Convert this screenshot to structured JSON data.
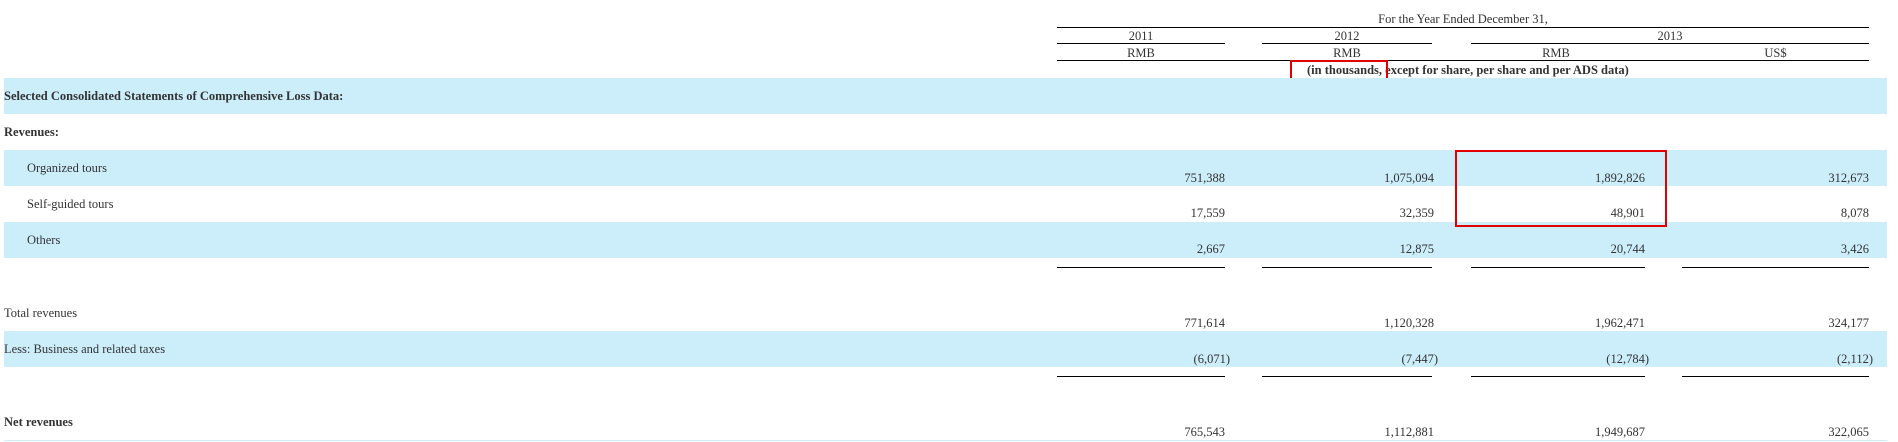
{
  "header": {
    "period": "For the Year Ended December 31,",
    "years": [
      "2011",
      "2012",
      "2013"
    ],
    "currencies": [
      "RMB",
      "RMB",
      "RMB",
      "US$"
    ],
    "units_note": "(in thousands, except for share, per share and per ADS data)"
  },
  "section_title": "Selected Consolidated Statements of Comprehensive Loss Data:",
  "revenues_label": "Revenues:",
  "rows": [
    {
      "label": "Organized tours",
      "values": [
        "751,388",
        "1,075,094",
        "1,892,826",
        "312,673"
      ]
    },
    {
      "label": "Self-guided tours",
      "values": [
        "17,559",
        "32,359",
        "48,901",
        "8,078"
      ]
    },
    {
      "label": "Others",
      "values": [
        "2,667",
        "12,875",
        "20,744",
        "3,426"
      ]
    },
    {
      "label": "Total revenues",
      "values": [
        "771,614",
        "1,120,328",
        "1,962,471",
        "324,177"
      ]
    },
    {
      "label": "Less: Business and related taxes",
      "values": [
        "(6,071)",
        "(7,447)",
        "(12,784)",
        "(2,112)"
      ]
    },
    {
      "label": "Net revenues",
      "values": [
        "765,543",
        "1,112,881",
        "1,949,687",
        "322,065"
      ]
    }
  ],
  "colors": {
    "band": "#cceefb",
    "highlight": "#e00000"
  }
}
